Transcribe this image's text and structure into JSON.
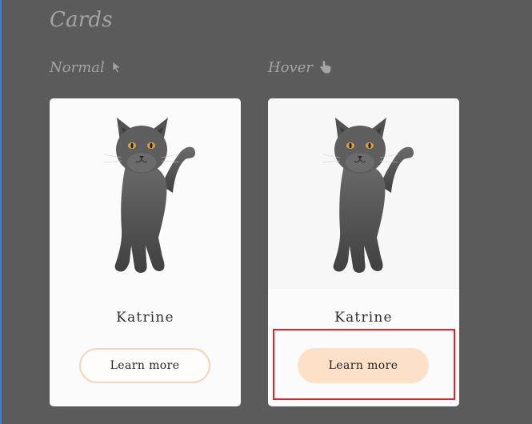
{
  "page": {
    "title": "Cards"
  },
  "columns": {
    "normal": {
      "label": "Normal",
      "icon": "cursor-arrow-icon"
    },
    "hover": {
      "label": "Hover",
      "icon": "cursor-pointer-icon"
    }
  },
  "cards": {
    "normal": {
      "image": "cat-image",
      "name": "Katrine",
      "button_label": "Learn more"
    },
    "hover": {
      "image": "cat-image",
      "name": "Katrine",
      "button_label": "Learn more"
    }
  },
  "colors": {
    "background": "#5b5b5b",
    "card": "#fbfbfb",
    "button_border": "#f3d4bb",
    "button_hover_fill": "#fde0c8",
    "focus_outline": "#d62834"
  }
}
